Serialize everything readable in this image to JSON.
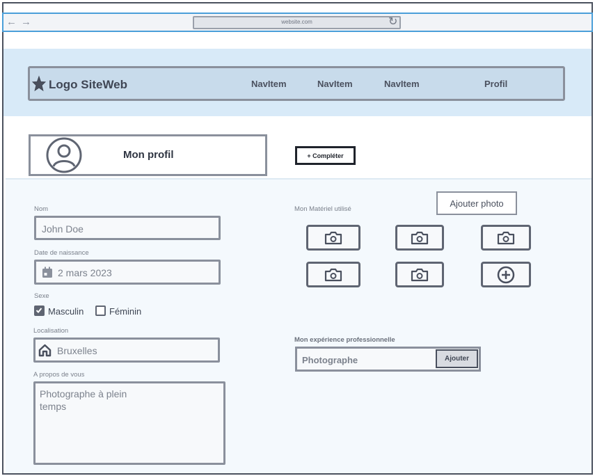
{
  "browser": {
    "url": "website.com",
    "back_icon": "arrow-left-icon",
    "forward_icon": "arrow-right-icon",
    "reload_icon": "reload-icon"
  },
  "nav": {
    "logo_label": "Logo SiteWeb",
    "items": [
      {
        "label": "NavItem"
      },
      {
        "label": "NavItem"
      },
      {
        "label": "NavItem"
      }
    ],
    "profile_label": "Profil"
  },
  "profile": {
    "title": "Mon profil",
    "complete_button": "+ Compléter"
  },
  "form": {
    "name": {
      "label": "Nom",
      "value": "John Doe"
    },
    "birthdate": {
      "label": "Date de naissance",
      "value": "2 mars 2023"
    },
    "sex": {
      "label": "Sexe",
      "options": [
        {
          "label": "Masculin",
          "checked": true
        },
        {
          "label": "Féminin",
          "checked": false
        }
      ]
    },
    "location": {
      "label": "Localisation",
      "value": "Bruxelles"
    },
    "about": {
      "label": "A propos de vous",
      "value": "Photographe à plein\ntemps"
    }
  },
  "equipment": {
    "label": "Mon Matériel utilisé",
    "add_photo_button": "Ajouter photo"
  },
  "experience": {
    "label": "Mon expérience professionnelle",
    "value": "Photographe",
    "add_button": "Ajouter"
  },
  "colors": {
    "hero_bg": "#d8eaf8",
    "nav_bg": "#c8dbeb",
    "panel_bg": "#f4f9fd",
    "browser_accent": "#4a9fd9"
  }
}
